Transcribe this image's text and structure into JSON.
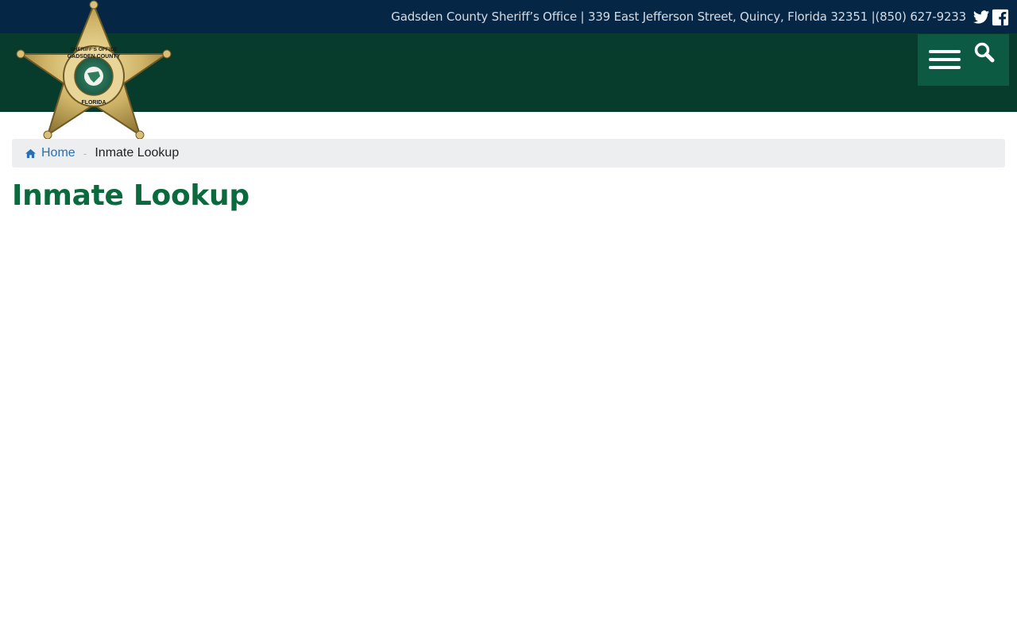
{
  "header": {
    "contact_line": "Gadsden County Sheriff’s Office | 339 East Jefferson Street, Quincy, Florida 32351 |(850) 627-9233",
    "social": [
      {
        "icon": "twitter-icon"
      },
      {
        "icon": "facebook-icon"
      }
    ],
    "logo": {
      "icon": "sheriff-star-badge-logo",
      "text_top": "SHERIFF'S OFFICE",
      "text_mid": "GADSDEN COUNTY",
      "text_bottom": "FLORIDA"
    },
    "menu": {
      "icon": "hamburger-menu-icon"
    },
    "search": {
      "icon": "search-icon"
    }
  },
  "breadcrumb": {
    "home_label": "Home",
    "home_icon": "home-icon",
    "separator": "-",
    "current": "Inmate Lookup"
  },
  "page": {
    "title": "Inmate Lookup"
  },
  "colors": {
    "topbar": "#062646",
    "mainbar": "#073b2c",
    "menu_box": "#0d5a43",
    "title": "#0b6a3d",
    "link": "#2a6fb3",
    "breadcrumb_bg": "#eceef0"
  }
}
